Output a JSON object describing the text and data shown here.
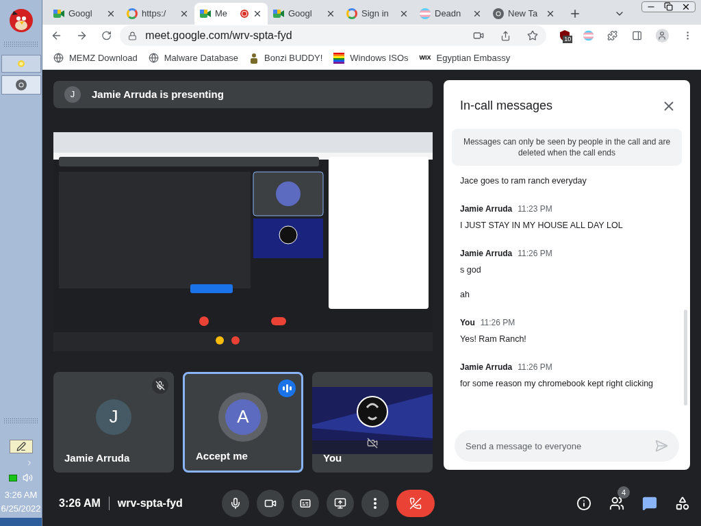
{
  "taskbar": {
    "clock": {
      "time": "3:26 AM",
      "date": "6/25/2022"
    }
  },
  "browser": {
    "tabs": [
      {
        "title": "Googl",
        "kind": "meet",
        "selected": false,
        "recording": false
      },
      {
        "title": "https:/",
        "kind": "google",
        "selected": false,
        "recording": false
      },
      {
        "title": "Me",
        "kind": "meet",
        "selected": true,
        "recording": true
      },
      {
        "title": "Googl",
        "kind": "meet",
        "selected": false,
        "recording": false
      },
      {
        "title": "Sign in",
        "kind": "google",
        "selected": false,
        "recording": false
      },
      {
        "title": "Deadn",
        "kind": "flag",
        "selected": false,
        "recording": false
      },
      {
        "title": "New Ta",
        "kind": "chrome",
        "selected": false,
        "recording": false
      }
    ],
    "url": "meet.google.com/wrv-spta-fyd",
    "extension_badge": "10",
    "bookmarks": [
      {
        "label": "MEMZ Download",
        "kind": "globe"
      },
      {
        "label": "Malware Database",
        "kind": "globe"
      },
      {
        "label": "Bonzi BUDDY!",
        "kind": "figure"
      },
      {
        "label": "Windows ISOs",
        "kind": "rainbow"
      },
      {
        "label": "Egyptian Embassy",
        "kind": "text",
        "icon_text": "WIX"
      }
    ]
  },
  "meeting": {
    "presenter_bar": {
      "initial": "J",
      "text": "Jamie Arruda is presenting"
    },
    "tiles": [
      {
        "kind": "avatar",
        "name": "Jamie Arruda",
        "initial": "J",
        "color": "#455a64",
        "muted": true,
        "speaking": false
      },
      {
        "kind": "avatar",
        "name": "Accept me",
        "initial": "A",
        "color": "#5c6bc0",
        "muted": false,
        "speaking": true
      },
      {
        "kind": "video",
        "name": "You",
        "muted": false,
        "speaking": false
      }
    ],
    "time": "3:26 AM",
    "meeting_code": "wrv-spta-fyd",
    "people_count": "4",
    "chat": {
      "title": "In-call messages",
      "notice": "Messages can only be seen by people in the call and are deleted when the call ends",
      "messages": [
        {
          "lines": [
            "Jace goes to ram ranch everyday"
          ]
        },
        {
          "sender": "Jamie Arruda",
          "time": "11:23 PM",
          "lines": [
            "I JUST STAY IN MY HOUSE ALL DAY LOL"
          ]
        },
        {
          "sender": "Jamie Arruda",
          "time": "11:26 PM",
          "lines": [
            "s god",
            "ah"
          ]
        },
        {
          "sender": "You",
          "time": "11:26 PM",
          "lines": [
            "Yes! Ram Ranch!"
          ]
        },
        {
          "sender": "Jamie Arruda",
          "time": "11:26 PM",
          "lines": [
            "for some reason my chromebook kept right clicking"
          ]
        }
      ],
      "placeholder": "Send a message to everyone"
    }
  }
}
